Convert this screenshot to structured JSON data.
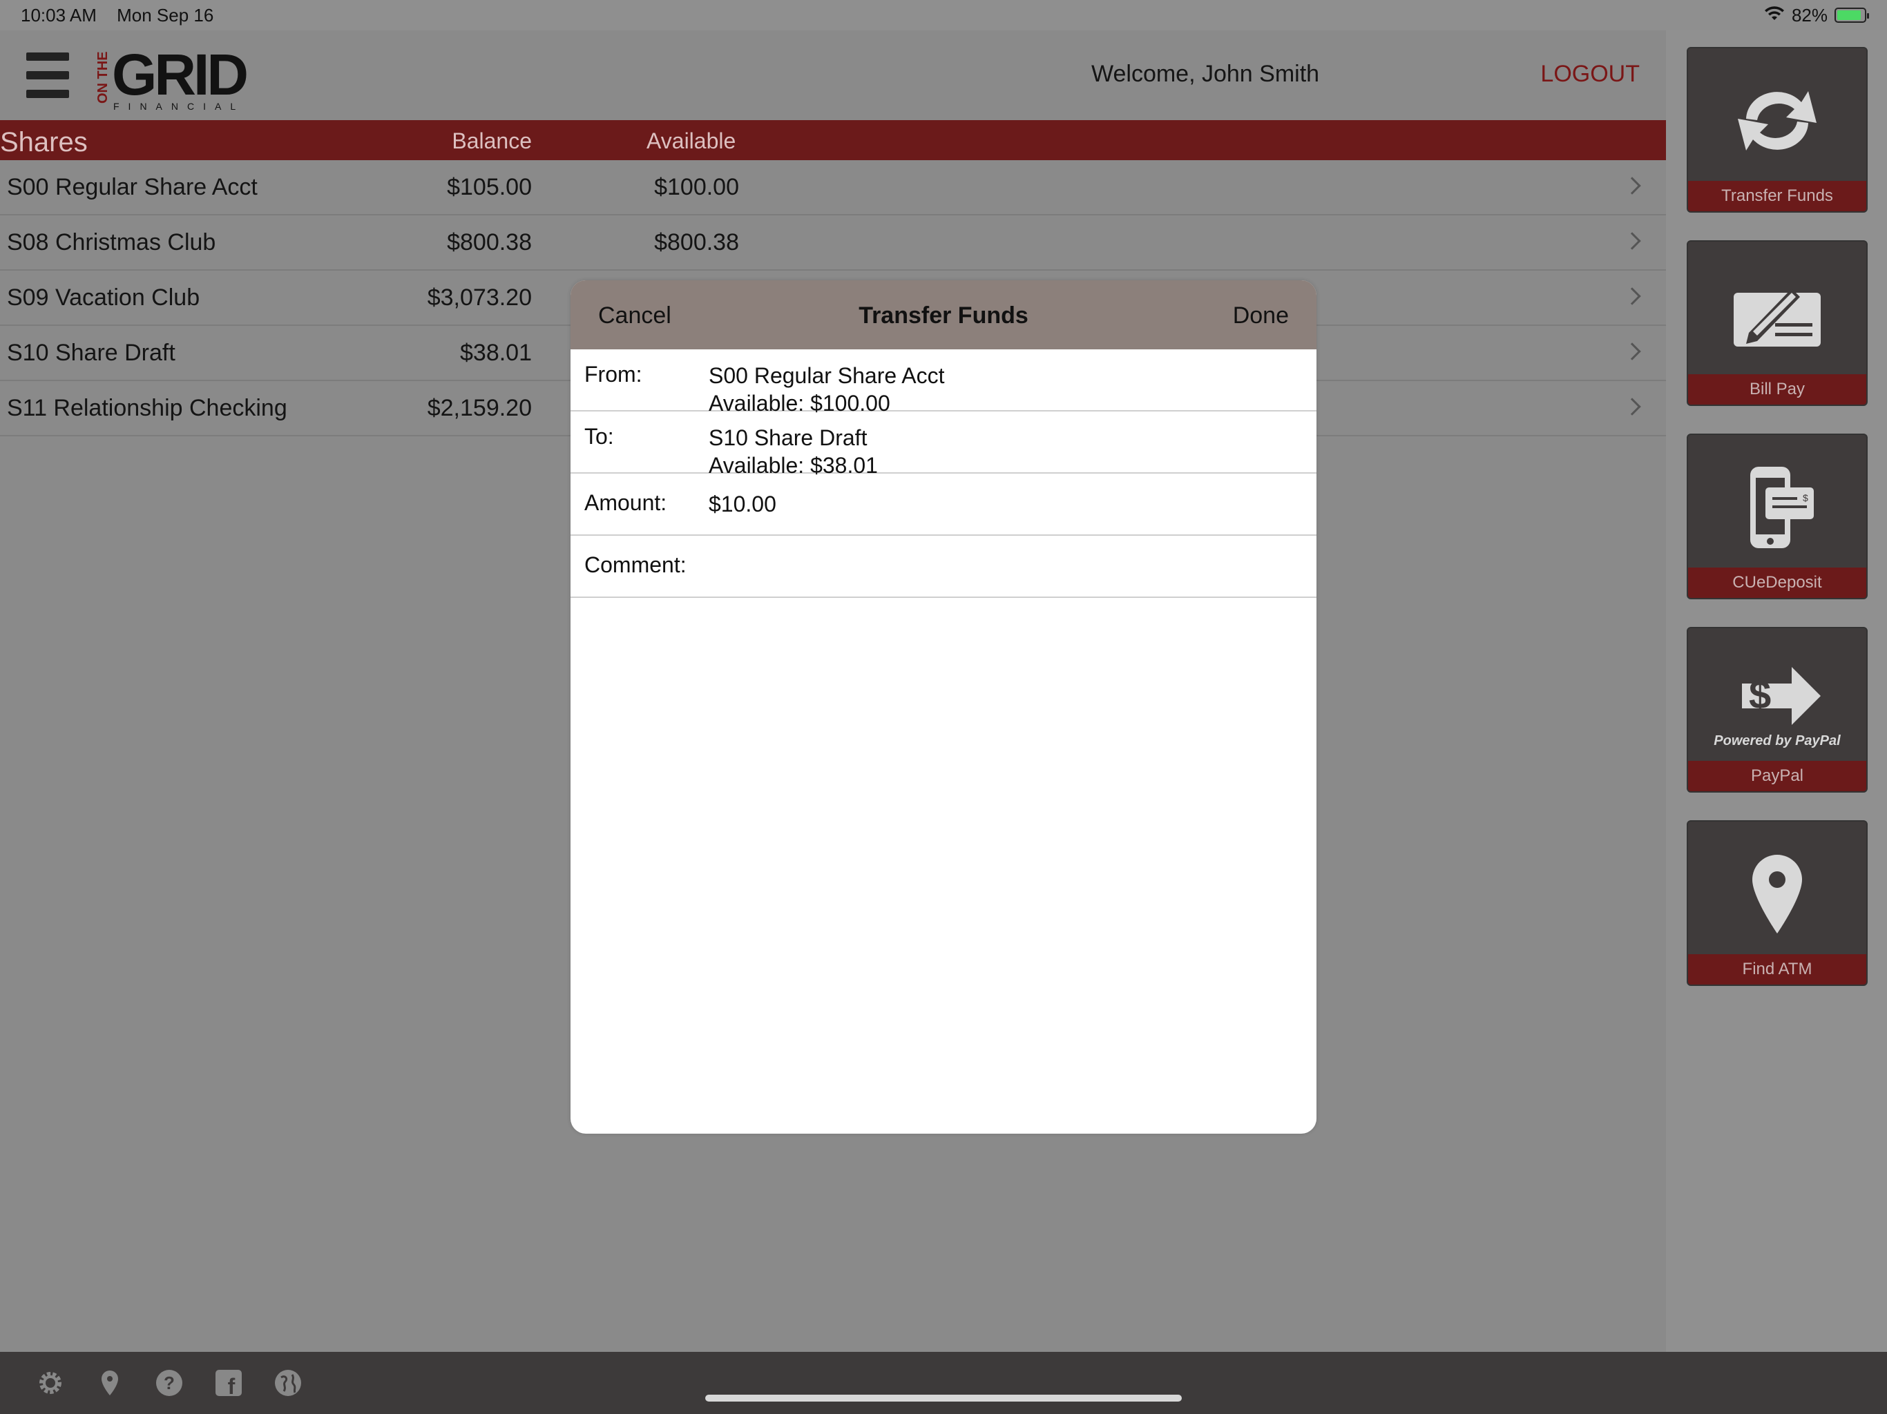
{
  "status_bar": {
    "time": "10:03 AM",
    "date": "Mon Sep 16",
    "battery": "82%"
  },
  "header": {
    "logo_main": "GRID",
    "logo_vertical": "ON THE",
    "logo_sub": "FINANCIAL",
    "welcome": "Welcome, John Smith",
    "logout": "LOGOUT"
  },
  "shares": {
    "title": "Shares",
    "col_balance": "Balance",
    "col_available": "Available",
    "rows": [
      {
        "name": "S00 Regular Share Acct",
        "balance": "$105.00",
        "available": "$100.00"
      },
      {
        "name": "S08 Christmas Club",
        "balance": "$800.38",
        "available": "$800.38"
      },
      {
        "name": "S09 Vacation Club",
        "balance": "$3,073.20",
        "available": ""
      },
      {
        "name": "S10 Share Draft",
        "balance": "$38.01",
        "available": ""
      },
      {
        "name": "S11 Relationship Checking",
        "balance": "$2,159.20",
        "available": ""
      }
    ]
  },
  "tiles": [
    {
      "label": "Transfer Funds",
      "icon": "transfer-icon"
    },
    {
      "label": "Bill Pay",
      "icon": "check-pen-icon"
    },
    {
      "label": "CUeDeposit",
      "icon": "mobile-deposit-icon"
    },
    {
      "label": "PayPal",
      "icon": "paypal-icon",
      "icon_text": "Powered by PayPal"
    },
    {
      "label": "Find ATM",
      "icon": "map-pin-icon"
    }
  ],
  "bottom_bar": {
    "icons": [
      "gear-icon",
      "location-icon",
      "help-icon",
      "facebook-icon",
      "globe-icon"
    ]
  },
  "modal": {
    "cancel": "Cancel",
    "title": "Transfer Funds",
    "done": "Done",
    "from_label": "From:",
    "from_account": "S00 Regular Share Acct",
    "from_available": "Available: $100.00",
    "to_label": "To:",
    "to_account": "S10 Share Draft",
    "to_available": "Available: $38.01",
    "amount_label": "Amount:",
    "amount_value": "$10.00",
    "comment_label": "Comment:",
    "comment_value": ""
  },
  "colors": {
    "accent_red": "#6b1a1a",
    "logout_red": "#7a1616",
    "modal_bar": "#8c807b",
    "tile_bg": "#3f3b3b"
  }
}
